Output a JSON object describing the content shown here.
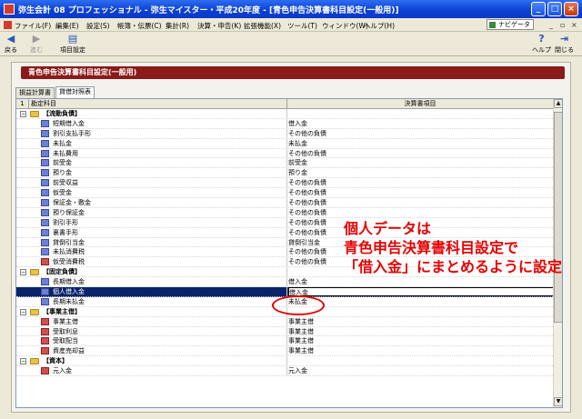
{
  "window": {
    "title": "弥生会計 08 プロフェッショナル - 弥生マイスター・平成20年度 - [青色申告決算書科目設定(一般用)]"
  },
  "menu": {
    "items": [
      "ファイル(F)",
      "編集(E)",
      "設定(S)",
      "帳簿・伝票(C)",
      "集計(R)",
      "決算・申告(K)",
      "拡張機能(X)",
      "ツール(T)",
      "ウィンドウ(W)",
      "ヘルプ(H)"
    ],
    "navi_label": "ナビゲータ"
  },
  "toolbar": {
    "back_label": "戻る",
    "forward_label": "進む",
    "item_settings_label": "項目設定",
    "help_label": "ヘルプ",
    "close_label": "閉じる"
  },
  "panel": {
    "header": "青色申告決算書科目設定(一般用)",
    "tabs": [
      "損益計算書",
      "貸借対照表"
    ]
  },
  "grid": {
    "header_num": "1",
    "col1": "勘定科目",
    "col2": "決算書項目",
    "rows": [
      {
        "type": "cat",
        "name": "【流動負債】",
        "item": ""
      },
      {
        "type": "acct",
        "name": "短期借入金",
        "item": "借入金"
      },
      {
        "type": "acct",
        "name": "割引支払手形",
        "item": "その他の負債"
      },
      {
        "type": "acct",
        "name": "未払金",
        "item": "未払金"
      },
      {
        "type": "acct",
        "name": "未払費用",
        "item": "その他の負債"
      },
      {
        "type": "acct",
        "name": "前受金",
        "item": "前受金"
      },
      {
        "type": "acct",
        "name": "預り金",
        "item": "預り金"
      },
      {
        "type": "acct",
        "name": "前受収益",
        "item": "その他の負債"
      },
      {
        "type": "acct",
        "name": "仮受金",
        "item": "その他の負債"
      },
      {
        "type": "acct",
        "name": "保証金・敷金",
        "item": "その他の負債"
      },
      {
        "type": "acct",
        "name": "預り保証金",
        "item": "その他の負債"
      },
      {
        "type": "acct",
        "name": "割引手形",
        "item": "その他の負債"
      },
      {
        "type": "acct",
        "name": "裏書手形",
        "item": "その他の負債"
      },
      {
        "type": "acct",
        "name": "貸倒引当金",
        "item": "貸倒引当金"
      },
      {
        "type": "acct",
        "name": "未払消費税",
        "item": "その他の負債"
      },
      {
        "type": "acct",
        "name": "仮受消費税",
        "item": "その他の負債",
        "red": true
      },
      {
        "type": "cat",
        "name": "【固定負債】",
        "item": ""
      },
      {
        "type": "acct",
        "name": "長期借入金",
        "item": "借入金"
      },
      {
        "type": "acct",
        "name": "個人借入金",
        "item": "借入金",
        "selected": true
      },
      {
        "type": "acct",
        "name": "長期未払金",
        "item": "未払金"
      },
      {
        "type": "cat",
        "name": "【事業主借】",
        "item": ""
      },
      {
        "type": "acct",
        "name": "事業主借",
        "item": "事業主借",
        "red": true
      },
      {
        "type": "acct",
        "name": "受取利息",
        "item": "事業主借",
        "red": true
      },
      {
        "type": "acct",
        "name": "受取配当",
        "item": "事業主借",
        "red": true
      },
      {
        "type": "acct",
        "name": "資産売却益",
        "item": "事業主借",
        "red": true
      },
      {
        "type": "cat",
        "name": "【資本】",
        "item": ""
      },
      {
        "type": "acct",
        "name": "元入金",
        "item": "元入金",
        "red": true
      }
    ]
  },
  "annotation": {
    "lines": [
      "個人データは",
      "青色申告決算書科目設定で",
      "「借入金」にまとめるように設定"
    ],
    "color": "#e60000"
  }
}
